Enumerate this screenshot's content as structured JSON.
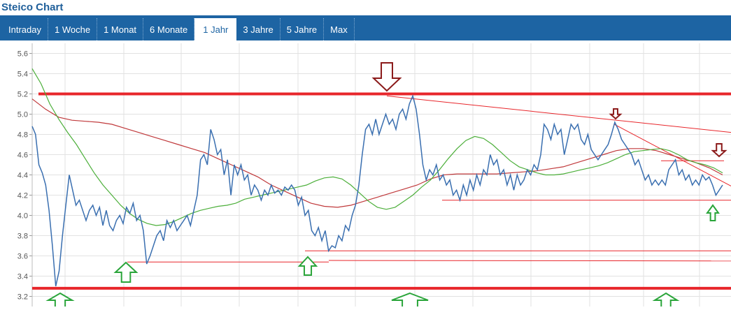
{
  "title": "Steico Chart",
  "tabs": [
    {
      "label": "Intraday",
      "active": false
    },
    {
      "label": "1 Woche",
      "active": false
    },
    {
      "label": "1 Monat",
      "active": false
    },
    {
      "label": "6 Monate",
      "active": false
    },
    {
      "label": "1 Jahr",
      "active": true
    },
    {
      "label": "3 Jahre",
      "active": false
    },
    {
      "label": "5 Jahre",
      "active": false
    },
    {
      "label": "Max",
      "active": false
    }
  ],
  "colors": {
    "tabbar": "#1d64a3",
    "price_line": "#3a6fb0",
    "ma_short": "#4caf3a",
    "ma_long": "#c0393b",
    "support_resistance": "#e8262b",
    "arrow_down": "#8b1a1a",
    "arrow_up": "#2aa53a",
    "grid": "#e2e2e2"
  },
  "chart_data": {
    "type": "line",
    "title": "",
    "xlabel": "",
    "ylabel": "",
    "ylim": [
      3.1,
      5.7
    ],
    "y_ticks": [
      "5.6",
      "5.4",
      "5.2",
      "5.0",
      "4.8",
      "4.6",
      "4.4",
      "4.2",
      "4.0",
      "3.8",
      "3.6",
      "3.4",
      "3.2"
    ],
    "x_ticks": [],
    "grid": true,
    "x": [
      0,
      1,
      2,
      3,
      4,
      5,
      6,
      7,
      8,
      9,
      10,
      11,
      12,
      13,
      14,
      15,
      16,
      17,
      18,
      19,
      20,
      21,
      22,
      23,
      24,
      25,
      26,
      27,
      28,
      29,
      30,
      31,
      32,
      33,
      34,
      35,
      36,
      37,
      38,
      39,
      40,
      41,
      42,
      43,
      44,
      45,
      46,
      47,
      48,
      49,
      50,
      51,
      52,
      53,
      54,
      55,
      56,
      57,
      58,
      59,
      60,
      61,
      62,
      63,
      64,
      65,
      66,
      67,
      68,
      69,
      70,
      71,
      72,
      73,
      74,
      75,
      76,
      77,
      78,
      79,
      80,
      81,
      82,
      83,
      84,
      85,
      86,
      87,
      88,
      89,
      90,
      91,
      92,
      93,
      94,
      95,
      96,
      97,
      98,
      99,
      100,
      101,
      102,
      103,
      104,
      105,
      106,
      107,
      108,
      109,
      110,
      111,
      112,
      113,
      114,
      115,
      116,
      117,
      118,
      119,
      120,
      121,
      122,
      123,
      124,
      125,
      126,
      127,
      128,
      129,
      130,
      131,
      132,
      133,
      134,
      135,
      136,
      137,
      138,
      139,
      140,
      141,
      142,
      143,
      144,
      145,
      146,
      147,
      148,
      149,
      150,
      151,
      152,
      153,
      154,
      155,
      156,
      157,
      158,
      159,
      160,
      161,
      162,
      163,
      164,
      165,
      166,
      167,
      168,
      169,
      170,
      171,
      172,
      173,
      174,
      175,
      176,
      177,
      178,
      179,
      180,
      181,
      182,
      183,
      184,
      185,
      186,
      187,
      188,
      189,
      190,
      191,
      192,
      193,
      194,
      195,
      196,
      197,
      198,
      199,
      200,
      201,
      202,
      203,
      204,
      205,
      206,
      207,
      208,
      209,
      210,
      211,
      212,
      213,
      214,
      215,
      216,
      217,
      218,
      219,
      220,
      221,
      222,
      223,
      224,
      225,
      226,
      227,
      228,
      229,
      230,
      231,
      232,
      233,
      234,
      235,
      236,
      237,
      238,
      239,
      240,
      241,
      242,
      243,
      244,
      245,
      246,
      247,
      248,
      249,
      250,
      251,
      252,
      253,
      254,
      255
    ],
    "series": [
      {
        "name": "",
        "role": "price",
        "values": [
          4.88,
          4.8,
          4.5,
          4.42,
          4.3,
          4.05,
          3.7,
          3.3,
          3.45,
          3.8,
          4.1,
          4.4,
          4.25,
          4.1,
          4.15,
          4.05,
          3.95,
          4.05,
          4.1,
          4.0,
          4.08,
          3.9,
          4.05,
          3.9,
          3.85,
          3.95,
          4.0,
          3.92,
          4.08,
          4.02,
          4.12,
          3.95,
          4.0,
          3.85,
          3.52,
          3.6,
          3.7,
          3.8,
          3.85,
          3.75,
          3.95,
          3.88,
          3.95,
          3.85,
          3.9,
          3.95,
          4.0,
          3.9,
          4.05,
          4.2,
          4.55,
          4.6,
          4.5,
          4.85,
          4.75,
          4.6,
          4.65,
          4.4,
          4.55,
          4.2,
          4.5,
          4.4,
          4.5,
          4.35,
          4.4,
          4.2,
          4.3,
          4.25,
          4.15,
          4.25,
          4.2,
          4.3,
          4.22,
          4.25,
          4.2,
          4.28,
          4.25,
          4.3,
          4.25,
          4.1,
          4.18,
          4.0,
          4.05,
          3.85,
          3.8,
          3.88,
          3.75,
          3.85,
          3.65,
          3.7,
          3.68,
          3.8,
          3.75,
          3.9,
          3.85,
          4.0,
          4.1,
          4.3,
          4.6,
          4.85,
          4.9,
          4.8,
          4.95,
          4.8,
          4.9,
          5.0,
          4.9,
          4.95,
          4.85,
          5.0,
          5.05,
          4.95,
          5.1,
          5.18,
          5.05,
          4.8,
          4.5,
          4.35,
          4.45,
          4.4,
          4.5,
          4.35,
          4.4,
          4.3,
          4.35,
          4.2,
          4.25,
          4.15,
          4.3,
          4.2,
          4.35,
          4.25,
          4.4,
          4.3,
          4.45,
          4.4,
          4.6,
          4.5,
          4.55,
          4.4,
          4.45,
          4.3,
          4.4,
          4.25,
          4.4,
          4.3,
          4.35,
          4.45,
          4.4,
          4.5,
          4.45,
          4.6,
          4.9,
          4.85,
          4.75,
          4.9,
          4.8,
          4.85,
          4.6,
          4.75,
          4.9,
          4.85,
          4.9,
          4.75,
          4.7,
          4.8,
          4.65,
          4.6,
          4.55,
          4.6,
          4.65,
          4.7,
          4.8,
          4.92,
          4.85,
          4.75,
          4.7,
          4.65,
          4.6,
          4.5,
          4.55,
          4.45,
          4.35,
          4.4,
          4.3,
          4.35,
          4.3,
          4.35,
          4.3,
          4.45,
          4.5,
          4.55,
          4.4,
          4.45,
          4.35,
          4.4,
          4.3,
          4.35,
          4.3,
          4.4,
          4.35,
          4.38,
          4.3,
          4.2,
          4.25,
          4.3
        ],
        "color_key": "price_line"
      },
      {
        "name": "",
        "role": "moving-average-short",
        "values": [
          5.45,
          5.3,
          5.1,
          4.95,
          4.82,
          4.7,
          4.56,
          4.42,
          4.3,
          4.2,
          4.1,
          4.02,
          3.96,
          3.92,
          3.9,
          3.91,
          3.94,
          3.98,
          4.02,
          4.05,
          4.07,
          4.09,
          4.1,
          4.12,
          4.16,
          4.18,
          4.2,
          4.22,
          4.24,
          4.26,
          4.28,
          4.3,
          4.34,
          4.37,
          4.38,
          4.36,
          4.3,
          4.22,
          4.14,
          4.08,
          4.06,
          4.08,
          4.14,
          4.2,
          4.28,
          4.35,
          4.45,
          4.56,
          4.66,
          4.74,
          4.78,
          4.76,
          4.7,
          4.62,
          4.54,
          4.48,
          4.45,
          4.42,
          4.4,
          4.4,
          4.41,
          4.43,
          4.45,
          4.47,
          4.49,
          4.52,
          4.56,
          4.6,
          4.63,
          4.64,
          4.65,
          4.66,
          4.64,
          4.6,
          4.55,
          4.52,
          4.5,
          4.47,
          4.42
        ],
        "color_key": "ma_short"
      },
      {
        "name": "",
        "role": "moving-average-long",
        "values": [
          5.15,
          5.05,
          4.97,
          4.94,
          4.93,
          4.92,
          4.9,
          4.86,
          4.82,
          4.78,
          4.74,
          4.7,
          4.66,
          4.62,
          4.56,
          4.5,
          4.44,
          4.38,
          4.3,
          4.24,
          4.18,
          4.12,
          4.09,
          4.08,
          4.1,
          4.14,
          4.18,
          4.22,
          4.26,
          4.3,
          4.36,
          4.4,
          4.41,
          4.41,
          4.41,
          4.41,
          4.42,
          4.43,
          4.44,
          4.46,
          4.48,
          4.52,
          4.56,
          4.6,
          4.64,
          4.66,
          4.66,
          4.64,
          4.6,
          4.56,
          4.52,
          4.47,
          4.4
        ],
        "color_key": "ma_long"
      }
    ],
    "annotations": {
      "horizontal_levels": [
        5.2,
        3.28,
        4.15,
        3.65,
        3.55,
        4.54
      ],
      "down_arrows": 3,
      "up_arrows": 7
    }
  }
}
